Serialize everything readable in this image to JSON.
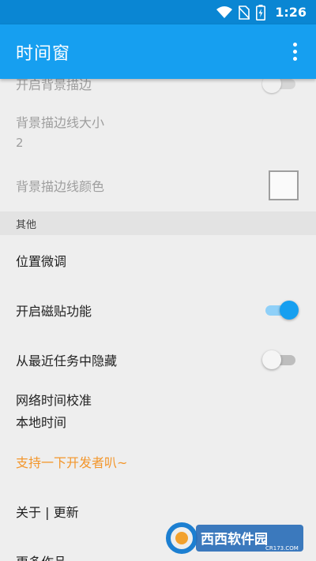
{
  "status_bar": {
    "time": "1:26",
    "icons": [
      "wifi-icon",
      "no-sim-icon",
      "battery-charging-icon"
    ]
  },
  "app_bar": {
    "title": "时间窗",
    "menu_icon": "more-vert-icon"
  },
  "settings": {
    "border_toggle": {
      "title": "开启背景描边",
      "checked": false,
      "enabled": false
    },
    "border_width": {
      "title": "背景描边线大小",
      "value": "2"
    },
    "border_color": {
      "title": "背景描边线颜色",
      "swatch": "#fafafa"
    },
    "section_other": "其他",
    "fine_tune": {
      "title": "位置微调"
    },
    "snap": {
      "title": "开启磁贴功能",
      "checked": true
    },
    "hide_recents": {
      "title": "从最近任务中隐藏",
      "checked": false
    },
    "net_time": {
      "title": "网络时间校准",
      "value": "本地时间"
    },
    "support": {
      "title": "支持一下开发者叭~"
    },
    "about": {
      "title": "关于 | 更新"
    },
    "more_works": {
      "title": "更多作品"
    }
  },
  "watermark": {
    "brand": "西西软件园",
    "site": "CR173.COM"
  },
  "colors": {
    "status_bar": "#0a86d3",
    "primary": "#169ff0",
    "accent": "#f3962b",
    "background": "#eeeeee"
  }
}
